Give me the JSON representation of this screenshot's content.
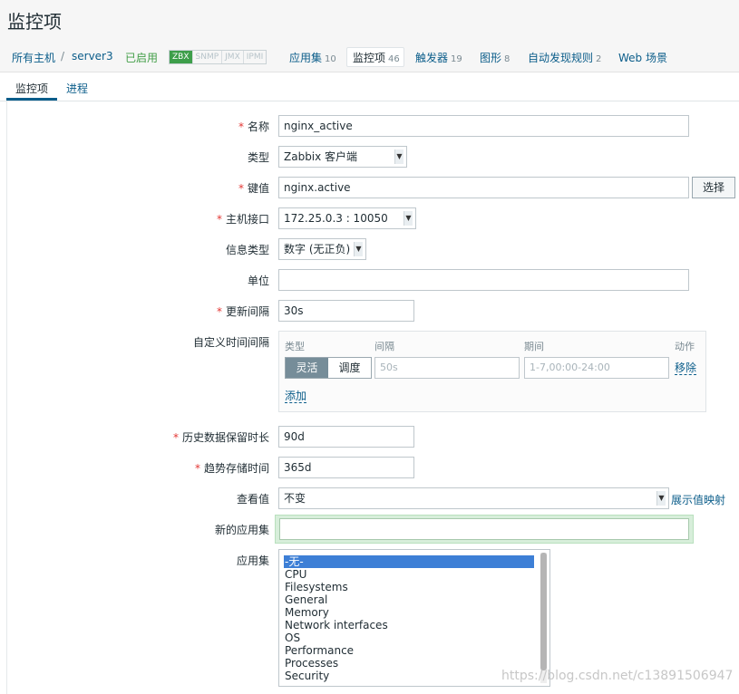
{
  "page": {
    "title": "监控项"
  },
  "breadcrumb": {
    "all_hosts": "所有主机",
    "separator": "/",
    "host": "server3",
    "enabled": "已启用",
    "status_badges": [
      "ZBX",
      "SNMP",
      "JMX",
      "IPMI"
    ],
    "tabs": [
      {
        "label": "应用集",
        "count": "10"
      },
      {
        "label": "监控项",
        "count": "46"
      },
      {
        "label": "触发器",
        "count": "19"
      },
      {
        "label": "图形",
        "count": "8"
      },
      {
        "label": "自动发现规则",
        "count": "2"
      },
      {
        "label": "Web 场景",
        "count": ""
      }
    ]
  },
  "subtabs": {
    "items": "监控项",
    "process": "进程"
  },
  "form": {
    "name": {
      "label": "名称",
      "value": "nginx_active"
    },
    "type": {
      "label": "类型",
      "value": "Zabbix 客户端"
    },
    "key": {
      "label": "键值",
      "value": "nginx.active",
      "select_button": "选择"
    },
    "interface": {
      "label": "主机接口",
      "value": "172.25.0.3 : 10050"
    },
    "info_type": {
      "label": "信息类型",
      "value": "数字 (无正负)"
    },
    "units": {
      "label": "单位",
      "value": ""
    },
    "update_interval": {
      "label": "更新间隔",
      "value": "30s"
    },
    "custom_intervals": {
      "label": "自定义时间间隔",
      "headers": {
        "type": "类型",
        "interval": "间隔",
        "period": "期间",
        "action": "动作"
      },
      "modes": [
        "灵活",
        "调度"
      ],
      "interval_placeholder": "50s",
      "period_placeholder": "1-7,00:00-24:00",
      "remove": "移除",
      "add": "添加"
    },
    "history": {
      "label": "历史数据保留时长",
      "value": "90d"
    },
    "trends": {
      "label": "趋势存储时间",
      "value": "365d"
    },
    "show_value": {
      "label": "查看值",
      "value": "不变",
      "link": "展示值映射"
    },
    "new_application": {
      "label": "新的应用集",
      "value": ""
    },
    "applications": {
      "label": "应用集",
      "options": [
        "-无-",
        "CPU",
        "Filesystems",
        "General",
        "Memory",
        "Network interfaces",
        "OS",
        "Performance",
        "Processes",
        "Security"
      ],
      "selected": "-无-"
    }
  },
  "watermark": "https://blog.csdn.net/c13891506947",
  "colors": {
    "link": "#0b5d8a",
    "required": "#e33734",
    "enabled": "#429e47",
    "selected": "#3d7fd6"
  }
}
